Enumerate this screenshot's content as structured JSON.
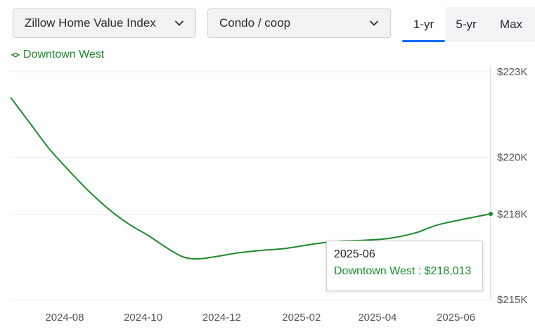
{
  "controls": {
    "index_select": {
      "value": "Zillow Home Value Index",
      "icon": "chevron-down-icon"
    },
    "type_select": {
      "value": "Condo / coop",
      "icon": "chevron-down-icon"
    },
    "ranges": [
      {
        "label": "1-yr",
        "active": true
      },
      {
        "label": "5-yr",
        "active": false
      },
      {
        "label": "Max",
        "active": false
      }
    ]
  },
  "colors": {
    "series": "#1e8a2c",
    "accent": "#006aff",
    "grid": "#eeeeee"
  },
  "tooltip": {
    "date": "2025-06",
    "series": "Downtown West",
    "value": "$218,013"
  },
  "chart_data": {
    "type": "line",
    "title": "",
    "xlabel": "",
    "ylabel": "",
    "legend_placement": "top-left",
    "grid": true,
    "y_axis_side": "right",
    "ylim": [
      215000,
      223000
    ],
    "y_ticks": [
      {
        "value": 215000,
        "label": "$215K"
      },
      {
        "value": 218000,
        "label": "$218K"
      },
      {
        "value": 220000,
        "label": "$220K"
      },
      {
        "value": 223000,
        "label": "$223K"
      }
    ],
    "x_range": [
      "2024-06-20",
      "2025-06-28"
    ],
    "x_ticks": [
      "2024-08",
      "2024-10",
      "2024-12",
      "2025-02",
      "2025-04",
      "2025-06"
    ],
    "series": [
      {
        "name": "Downtown West",
        "points": [
          {
            "x": "2024-06-20",
            "y": 222100
          },
          {
            "x": "2024-07-05",
            "y": 221200
          },
          {
            "x": "2024-07-20",
            "y": 220300
          },
          {
            "x": "2024-08-05",
            "y": 219500
          },
          {
            "x": "2024-08-20",
            "y": 218800
          },
          {
            "x": "2024-09-05",
            "y": 218150
          },
          {
            "x": "2024-09-20",
            "y": 217650
          },
          {
            "x": "2024-10-05",
            "y": 217250
          },
          {
            "x": "2024-10-20",
            "y": 216800
          },
          {
            "x": "2024-11-01",
            "y": 216500
          },
          {
            "x": "2024-11-12",
            "y": 216430
          },
          {
            "x": "2024-11-25",
            "y": 216500
          },
          {
            "x": "2024-12-15",
            "y": 216650
          },
          {
            "x": "2025-01-01",
            "y": 216730
          },
          {
            "x": "2025-01-20",
            "y": 216800
          },
          {
            "x": "2025-02-10",
            "y": 216950
          },
          {
            "x": "2025-03-01",
            "y": 217050
          },
          {
            "x": "2025-03-20",
            "y": 217080
          },
          {
            "x": "2025-04-10",
            "y": 217150
          },
          {
            "x": "2025-05-01",
            "y": 217350
          },
          {
            "x": "2025-05-20",
            "y": 217650
          },
          {
            "x": "2025-06-28",
            "y": 218013
          }
        ]
      }
    ]
  }
}
